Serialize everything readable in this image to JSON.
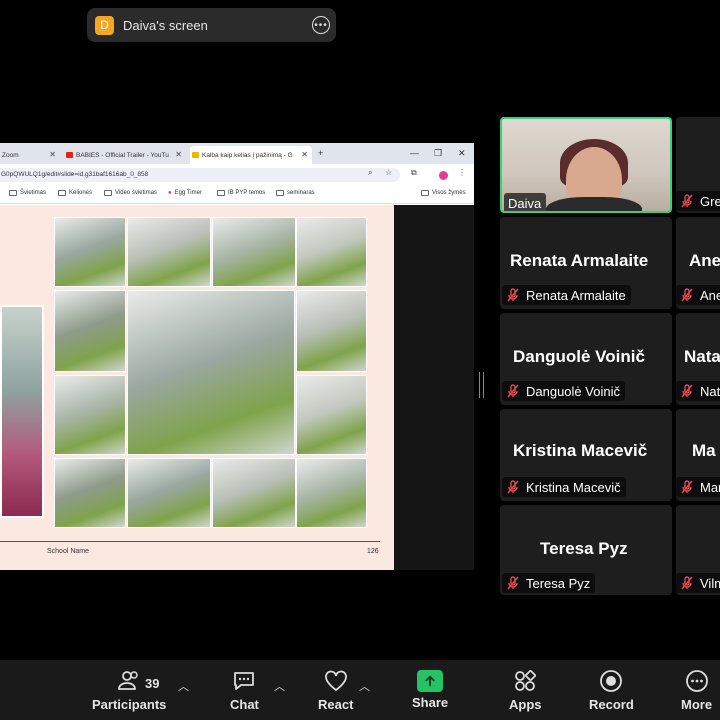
{
  "share_banner": {
    "avatar_letter": "D",
    "title": "Daiva's screen"
  },
  "browser": {
    "tabs": [
      {
        "label": "Zoom"
      },
      {
        "label": "BABIES - Official Trailer - YouTu"
      },
      {
        "label": "Kalba kaip kelias į pažinimą - G"
      }
    ],
    "url": "G0pQWULQ1g/edit#slide=id.g31baf1616ab_0_858",
    "bookmarks": [
      "Švietimas",
      "Kelionės",
      "Video švietimas",
      "Egg Timer",
      "IB PYP temos",
      "seminaras",
      "Visos žymės"
    ]
  },
  "slide": {
    "school_label": "School Name",
    "page_number": "126"
  },
  "participants": [
    {
      "id": "daiva",
      "tag": "Daiva"
    },
    {
      "id": "grete",
      "tag": "Gret"
    },
    {
      "id": "renata",
      "big": "Renata Armalaite",
      "tag": "Renata Armalaite"
    },
    {
      "id": "ane",
      "big": "Ane",
      "tag": "Ane"
    },
    {
      "id": "danguole",
      "big": "Danguolė Voinič",
      "tag": "Danguolė Voinič"
    },
    {
      "id": "nata",
      "big": "Nata",
      "tag": "Nata"
    },
    {
      "id": "kristina",
      "big": "Kristina Macevič",
      "tag": "Kristina Macevič"
    },
    {
      "id": "ma",
      "big": "Ma",
      "tag": "Mar"
    },
    {
      "id": "teresa",
      "big": "Teresa Pyz",
      "tag": "Teresa Pyz"
    },
    {
      "id": "vilm",
      "tag": "Vilm"
    }
  ],
  "toolbar": {
    "participants_label": "Participants",
    "participants_count": "39",
    "chat_label": "Chat",
    "react_label": "React",
    "share_label": "Share",
    "apps_label": "Apps",
    "record_label": "Record",
    "more_label": "More"
  },
  "colors": {
    "share_green": "#26c266",
    "speaker_border": "#36d17b",
    "muted_red": "#e5484d",
    "avatar_orange": "#f5a623"
  }
}
